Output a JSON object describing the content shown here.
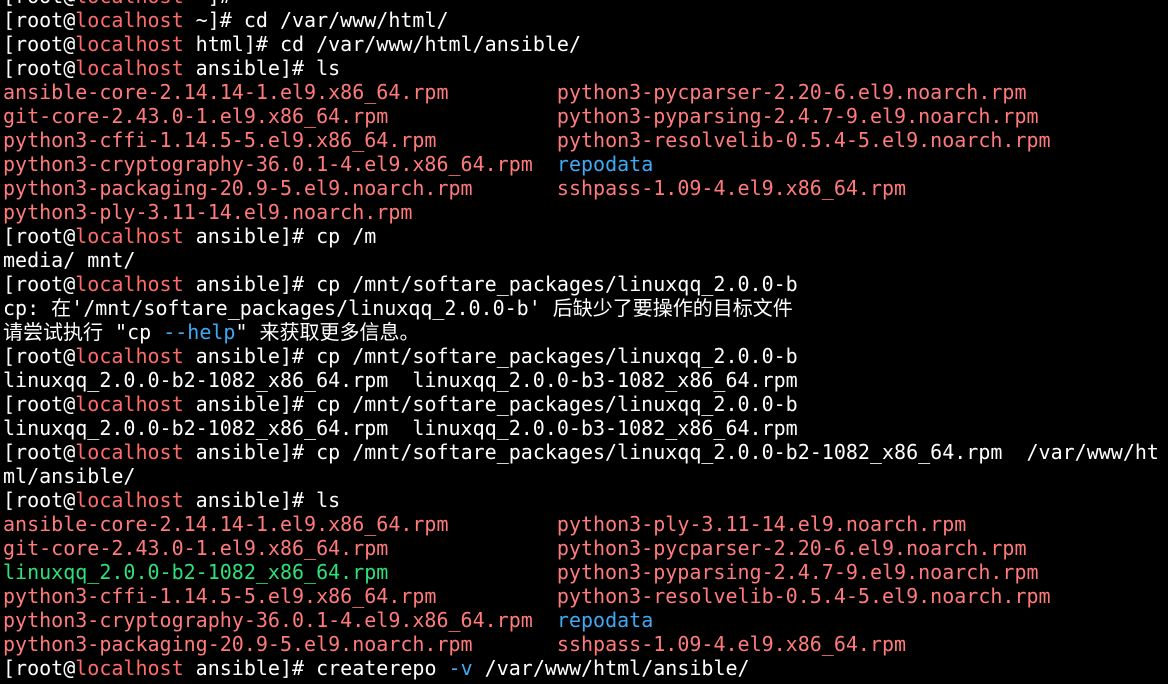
{
  "colors": {
    "background": "#000000",
    "text": "#ffffff",
    "host": "#ff6b6b",
    "package_file": "#ff7b7b",
    "directory": "#3fa9f5",
    "new_file": "#2fe07a",
    "option": "#3fa9f5"
  },
  "terminal": {
    "lines": [
      [
        {
          "t": "[root@",
          "c": "text"
        },
        {
          "t": "localhost",
          "c": "host"
        },
        {
          "t": " ~]#",
          "c": "text"
        }
      ],
      [
        {
          "t": "[root@",
          "c": "text"
        },
        {
          "t": "localhost",
          "c": "host"
        },
        {
          "t": " ~]# cd /var/www/html/",
          "c": "text"
        }
      ],
      [
        {
          "t": "[root@",
          "c": "text"
        },
        {
          "t": "localhost",
          "c": "host"
        },
        {
          "t": " html]# cd /var/www/html/ansible/",
          "c": "text"
        }
      ],
      [
        {
          "t": "[root@",
          "c": "text"
        },
        {
          "t": "localhost",
          "c": "host"
        },
        {
          "t": " ansible]# ls",
          "c": "text"
        }
      ],
      [
        {
          "t": "ansible-core-2.14.14-1.el9.x86_64.rpm",
          "c": "package_file"
        },
        {
          "t": "         ",
          "c": "text"
        },
        {
          "t": "python3-pycparser-2.20-6.el9.noarch.rpm",
          "c": "package_file"
        }
      ],
      [
        {
          "t": "git-core-2.43.0-1.el9.x86_64.rpm",
          "c": "package_file"
        },
        {
          "t": "              ",
          "c": "text"
        },
        {
          "t": "python3-pyparsing-2.4.7-9.el9.noarch.rpm",
          "c": "package_file"
        }
      ],
      [
        {
          "t": "python3-cffi-1.14.5-5.el9.x86_64.rpm",
          "c": "package_file"
        },
        {
          "t": "          ",
          "c": "text"
        },
        {
          "t": "python3-resolvelib-0.5.4-5.el9.noarch.rpm",
          "c": "package_file"
        }
      ],
      [
        {
          "t": "python3-cryptography-36.0.1-4.el9.x86_64.rpm",
          "c": "package_file"
        },
        {
          "t": "  ",
          "c": "text"
        },
        {
          "t": "repodata",
          "c": "directory"
        }
      ],
      [
        {
          "t": "python3-packaging-20.9-5.el9.noarch.rpm",
          "c": "package_file"
        },
        {
          "t": "       ",
          "c": "text"
        },
        {
          "t": "sshpass-1.09-4.el9.x86_64.rpm",
          "c": "package_file"
        }
      ],
      [
        {
          "t": "python3-ply-3.11-14.el9.noarch.rpm",
          "c": "package_file"
        }
      ],
      [
        {
          "t": "[root@",
          "c": "text"
        },
        {
          "t": "localhost",
          "c": "host"
        },
        {
          "t": " ansible]# cp /m",
          "c": "text"
        }
      ],
      [
        {
          "t": "media/ mnt/",
          "c": "text"
        }
      ],
      [
        {
          "t": "[root@",
          "c": "text"
        },
        {
          "t": "localhost",
          "c": "host"
        },
        {
          "t": " ansible]# cp /mnt/softare_packages/linuxqq_2.0.0-b",
          "c": "text"
        }
      ],
      [
        {
          "t": "cp: 在'/mnt/softare_packages/linuxqq_2.0.0-b' 后缺少了要操作的目标文件",
          "c": "text"
        }
      ],
      [
        {
          "t": "请尝试执行 \"cp ",
          "c": "text"
        },
        {
          "t": "--help",
          "c": "option"
        },
        {
          "t": "\" 来获取更多信息。",
          "c": "text"
        }
      ],
      [
        {
          "t": "[root@",
          "c": "text"
        },
        {
          "t": "localhost",
          "c": "host"
        },
        {
          "t": " ansible]# cp /mnt/softare_packages/linuxqq_2.0.0-b",
          "c": "text"
        }
      ],
      [
        {
          "t": "linuxqq_2.0.0-b2-1082_x86_64.rpm  linuxqq_2.0.0-b3-1082_x86_64.rpm",
          "c": "text"
        }
      ],
      [
        {
          "t": "[root@",
          "c": "text"
        },
        {
          "t": "localhost",
          "c": "host"
        },
        {
          "t": " ansible]# cp /mnt/softare_packages/linuxqq_2.0.0-b",
          "c": "text"
        }
      ],
      [
        {
          "t": "linuxqq_2.0.0-b2-1082_x86_64.rpm  linuxqq_2.0.0-b3-1082_x86_64.rpm",
          "c": "text"
        }
      ],
      [
        {
          "t": "[root@",
          "c": "text"
        },
        {
          "t": "localhost",
          "c": "host"
        },
        {
          "t": " ansible]# cp /mnt/softare_packages/linuxqq_2.0.0-b2-1082_x86_64.rpm  /var/www/ht",
          "c": "text"
        }
      ],
      [
        {
          "t": "ml/ansible/",
          "c": "text"
        }
      ],
      [
        {
          "t": "[root@",
          "c": "text"
        },
        {
          "t": "localhost",
          "c": "host"
        },
        {
          "t": " ansible]# ls",
          "c": "text"
        }
      ],
      [
        {
          "t": "ansible-core-2.14.14-1.el9.x86_64.rpm",
          "c": "package_file"
        },
        {
          "t": "         ",
          "c": "text"
        },
        {
          "t": "python3-ply-3.11-14.el9.noarch.rpm",
          "c": "package_file"
        }
      ],
      [
        {
          "t": "git-core-2.43.0-1.el9.x86_64.rpm",
          "c": "package_file"
        },
        {
          "t": "              ",
          "c": "text"
        },
        {
          "t": "python3-pycparser-2.20-6.el9.noarch.rpm",
          "c": "package_file"
        }
      ],
      [
        {
          "t": "linuxqq_2.0.0-b2-1082_x86_64.rpm",
          "c": "new_file"
        },
        {
          "t": "              ",
          "c": "text"
        },
        {
          "t": "python3-pyparsing-2.4.7-9.el9.noarch.rpm",
          "c": "package_file"
        }
      ],
      [
        {
          "t": "python3-cffi-1.14.5-5.el9.x86_64.rpm",
          "c": "package_file"
        },
        {
          "t": "          ",
          "c": "text"
        },
        {
          "t": "python3-resolvelib-0.5.4-5.el9.noarch.rpm",
          "c": "package_file"
        }
      ],
      [
        {
          "t": "python3-cryptography-36.0.1-4.el9.x86_64.rpm",
          "c": "package_file"
        },
        {
          "t": "  ",
          "c": "text"
        },
        {
          "t": "repodata",
          "c": "directory"
        }
      ],
      [
        {
          "t": "python3-packaging-20.9-5.el9.noarch.rpm",
          "c": "package_file"
        },
        {
          "t": "       ",
          "c": "text"
        },
        {
          "t": "sshpass-1.09-4.el9.x86_64.rpm",
          "c": "package_file"
        }
      ],
      [
        {
          "t": "[root@",
          "c": "text"
        },
        {
          "t": "localhost",
          "c": "host"
        },
        {
          "t": " ansible]# createrepo ",
          "c": "text"
        },
        {
          "t": "-v",
          "c": "option"
        },
        {
          "t": " /var/www/html/ansible/",
          "c": "text"
        }
      ]
    ]
  }
}
